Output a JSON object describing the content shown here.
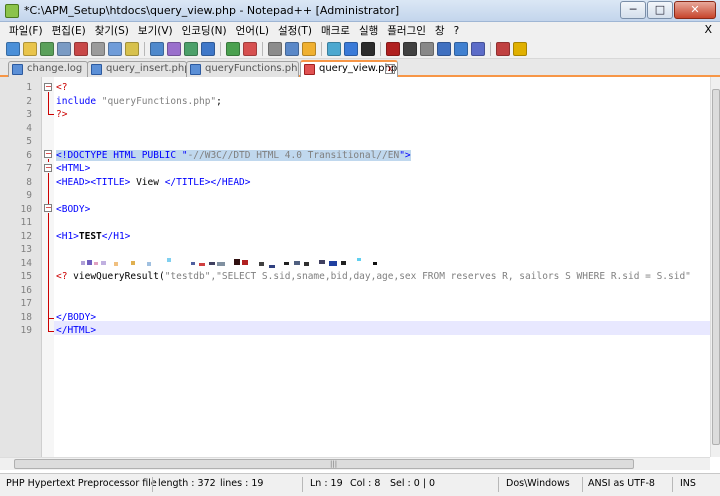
{
  "window": {
    "title": "*C:\\APM_Setup\\htdocs\\query_view.php - Notepad++ [Administrator]",
    "minimize": "─",
    "maximize": "□",
    "close": "✕"
  },
  "menu": {
    "items": [
      "파일(F)",
      "편집(E)",
      "찾기(S)",
      "보기(V)",
      "인코딩(N)",
      "언어(L)",
      "설정(T)",
      "매크로",
      "실행",
      "플러그인",
      "창",
      "?"
    ],
    "close_doc": "X"
  },
  "toolbar": {
    "colors": [
      "#4a8fd8",
      "#e9c44a",
      "#5aa05a",
      "#7a9bc4",
      "#c84848",
      "#9b9b9b",
      "#6f9cd9",
      "#d7c14d",
      "#4f89cc",
      "#9a6fcc",
      "#4ca06a",
      "#3e77c8",
      "#4aa04f",
      "#d65050",
      "#8c8c8c",
      "#5a88c8",
      "#f0b030",
      "#4ca8d0",
      "#3a7ad8",
      "#2c2c2c",
      "#b02020",
      "#404040",
      "#888888",
      "#4070c0",
      "#4080d0",
      "#5c6cc8",
      "#c04040",
      "#e0b000"
    ]
  },
  "tabs": [
    {
      "label": "change.log",
      "active": false
    },
    {
      "label": "query_insert.php",
      "active": false
    },
    {
      "label": "queryFunctions.php",
      "active": false
    },
    {
      "label": "query_view.php",
      "active": true
    }
  ],
  "editor": {
    "line_numbers": [
      "1",
      "2",
      "3",
      "4",
      "5",
      "6",
      "7",
      "8",
      "9",
      "10",
      "11",
      "12",
      "13",
      "14",
      "15",
      "16",
      "17",
      "18",
      "19"
    ],
    "lines": {
      "l1": "<?",
      "l2a": "include ",
      "l2b": "\"queryFunctions.php\"",
      "l2c": ";",
      "l3": "?>",
      "l6a": "<!DOCTYPE HTML PUBLIC \"",
      "l6b": "-//W3C//DTD HTML 4.0 Transitional//EN",
      "l6c": "\">",
      "l7": "<HTML>",
      "l8a": "<HEAD><TITLE>",
      "l8b": " View ",
      "l8c": "</TITLE></HEAD>",
      "l10": "<BODY>",
      "l12a": "<H1>",
      "l12b": "TEST",
      "l12c": "</H1>",
      "l15a": "<? ",
      "l15b": "viewQueryResult",
      "l15c": "(",
      "l15d": "\"testdb\",\"SELECT S.sid,sname,bid,day,age,sex FROM reserves R, sailors S WHERE R.sid = S.sid\"",
      "l18": "</BODY>",
      "l19": "</HTML>"
    }
  },
  "status": {
    "filetype": "PHP Hypertext Preprocessor file",
    "length": "length : 372",
    "lines": "lines : 19",
    "ln": "Ln : 19",
    "col": "Col : 8",
    "sel": "Sel : 0 | 0",
    "eol": "Dos\\Windows",
    "encoding": "ANSI as UTF-8",
    "mode": "INS"
  }
}
